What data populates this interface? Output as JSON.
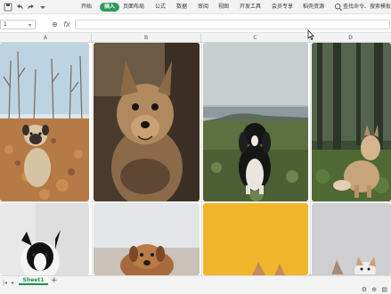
{
  "menubar": {
    "items": [
      {
        "label": "开始",
        "active": false
      },
      {
        "label": "插入",
        "active": true
      },
      {
        "label": "页面布局",
        "active": false
      },
      {
        "label": "公式",
        "active": false
      },
      {
        "label": "数据",
        "active": false
      },
      {
        "label": "审阅",
        "active": false
      },
      {
        "label": "视图",
        "active": false
      },
      {
        "label": "开发工具",
        "active": false
      },
      {
        "label": "会员专享",
        "active": false
      },
      {
        "label": "稻壳资源",
        "active": false
      }
    ],
    "search_label": "查找命令、搜索模板",
    "share_label": ""
  },
  "formula_bar": {
    "cell_ref": "1",
    "value": ""
  },
  "columns": [
    "A",
    "B",
    "C",
    "D"
  ],
  "photos": [
    {
      "subject": "pug dog sitting in autumn leaves"
    },
    {
      "subject": "yorkshire terrier portrait"
    },
    {
      "subject": "black and white spaniel on grass by the sea"
    },
    {
      "subject": "fluffy dog in a forest"
    },
    {
      "subject": "black and white dog"
    },
    {
      "subject": "brown dog lying down"
    },
    {
      "subject": "dog ears against yellow background"
    },
    {
      "subject": "small dog against grey background"
    }
  ],
  "sheet_tabs": [
    {
      "label": "Sheet1",
      "active": true
    }
  ],
  "colors": {
    "accent": "#2e9a5c",
    "tab_active": "#1f8c4d"
  }
}
